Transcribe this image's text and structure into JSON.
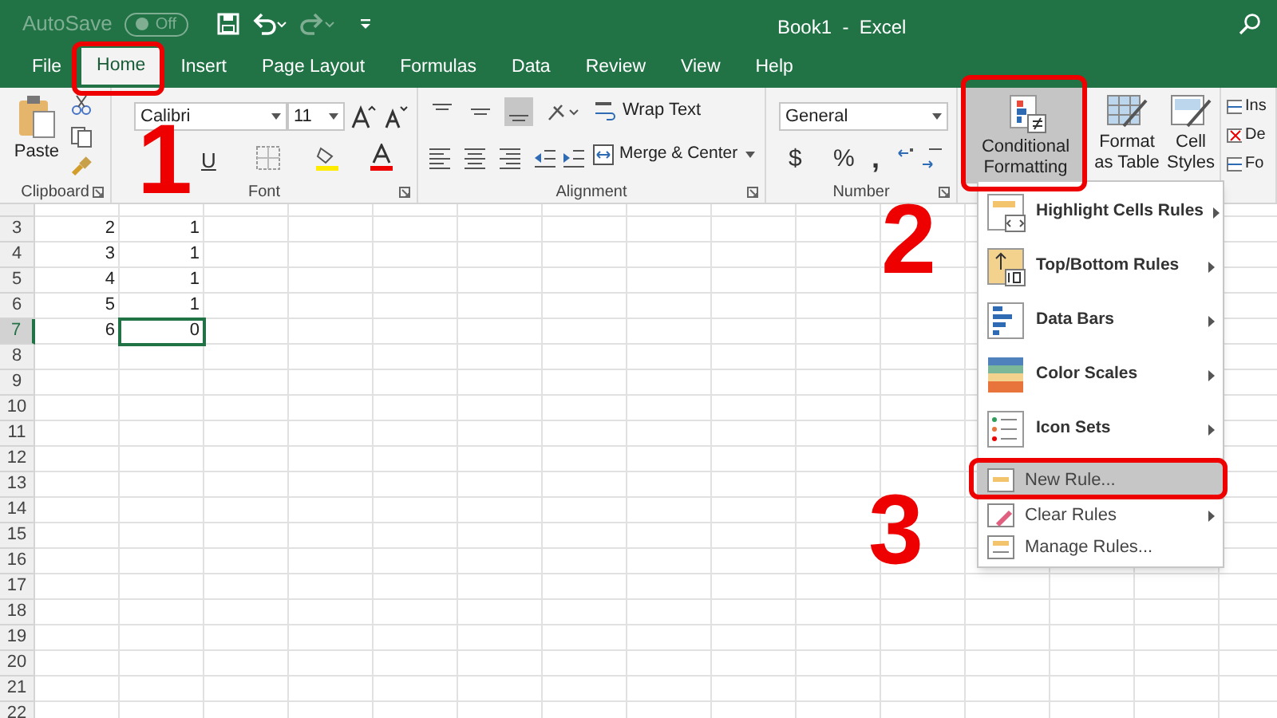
{
  "title_bar": {
    "autosave_label": "AutoSave",
    "autosave_state": "Off",
    "autosave_on": false,
    "title": "Book1  -  Excel"
  },
  "tabs": [
    {
      "label": "File",
      "selected": false
    },
    {
      "label": "Home",
      "selected": true
    },
    {
      "label": "Insert",
      "selected": false
    },
    {
      "label": "Page Layout",
      "selected": false
    },
    {
      "label": "Formulas",
      "selected": false
    },
    {
      "label": "Data",
      "selected": false
    },
    {
      "label": "Review",
      "selected": false
    },
    {
      "label": "View",
      "selected": false
    },
    {
      "label": "Help",
      "selected": false
    }
  ],
  "ribbon": {
    "clipboard": {
      "paste": "Paste",
      "label": "Clipboard"
    },
    "font": {
      "name": "Calibri",
      "size": "11",
      "underline": "U",
      "label": "Font"
    },
    "alignment": {
      "wrap": "Wrap Text",
      "merge": "Merge & Center",
      "label": "Alignment"
    },
    "number": {
      "format": "General",
      "currency": "$",
      "percent": "%",
      "comma": ",",
      "label": "Number"
    },
    "styles": {
      "conditional": "Conditional Formatting",
      "conditional_pressed": true,
      "format_table": "Format as Table",
      "cell_styles": "Cell Styles"
    },
    "cells": {
      "items": [
        "Ins",
        "De",
        "Fo"
      ]
    }
  },
  "sheet": {
    "rows": [
      {
        "header": "3",
        "cells": [
          {
            "value": "2",
            "selected": false
          },
          {
            "value": "1",
            "selected": false
          }
        ]
      },
      {
        "header": "4",
        "cells": [
          {
            "value": "3",
            "selected": false
          },
          {
            "value": "1",
            "selected": false
          }
        ]
      },
      {
        "header": "5",
        "cells": [
          {
            "value": "4",
            "selected": false
          },
          {
            "value": "1",
            "selected": false
          }
        ]
      },
      {
        "header": "6",
        "cells": [
          {
            "value": "5",
            "selected": false
          },
          {
            "value": "1",
            "selected": false
          }
        ]
      },
      {
        "header": "7",
        "cells": [
          {
            "value": "6",
            "selected": false
          },
          {
            "value": "0",
            "selected": true
          }
        ]
      },
      {
        "header": "8"
      },
      {
        "header": "9"
      },
      {
        "header": "10"
      },
      {
        "header": "11"
      },
      {
        "header": "12"
      },
      {
        "header": "13"
      },
      {
        "header": "14"
      },
      {
        "header": "15"
      },
      {
        "header": "16"
      },
      {
        "header": "17"
      },
      {
        "header": "18"
      },
      {
        "header": "19"
      },
      {
        "header": "20"
      },
      {
        "header": "21"
      },
      {
        "header": "22"
      }
    ]
  },
  "menu": {
    "items": [
      {
        "kind": "large",
        "label": "Highlight Cells Rules",
        "submenu": true,
        "selected": false
      },
      {
        "kind": "large",
        "label": "Top/Bottom Rules",
        "submenu": true,
        "selected": false
      },
      {
        "kind": "large",
        "label": "Data Bars",
        "submenu": true,
        "selected": false
      },
      {
        "kind": "large",
        "label": "Color Scales",
        "submenu": true,
        "selected": false
      },
      {
        "kind": "large",
        "label": "Icon Sets",
        "submenu": true,
        "selected": false
      },
      {
        "kind": "small",
        "label": "New Rule...",
        "submenu": false,
        "selected": true
      },
      {
        "kind": "small",
        "label": "Clear Rules",
        "submenu": true,
        "selected": false
      },
      {
        "kind": "small",
        "label": "Manage Rules...",
        "submenu": false,
        "selected": false
      }
    ]
  },
  "annotations": {
    "labels": [
      "1",
      "2",
      "3"
    ]
  }
}
